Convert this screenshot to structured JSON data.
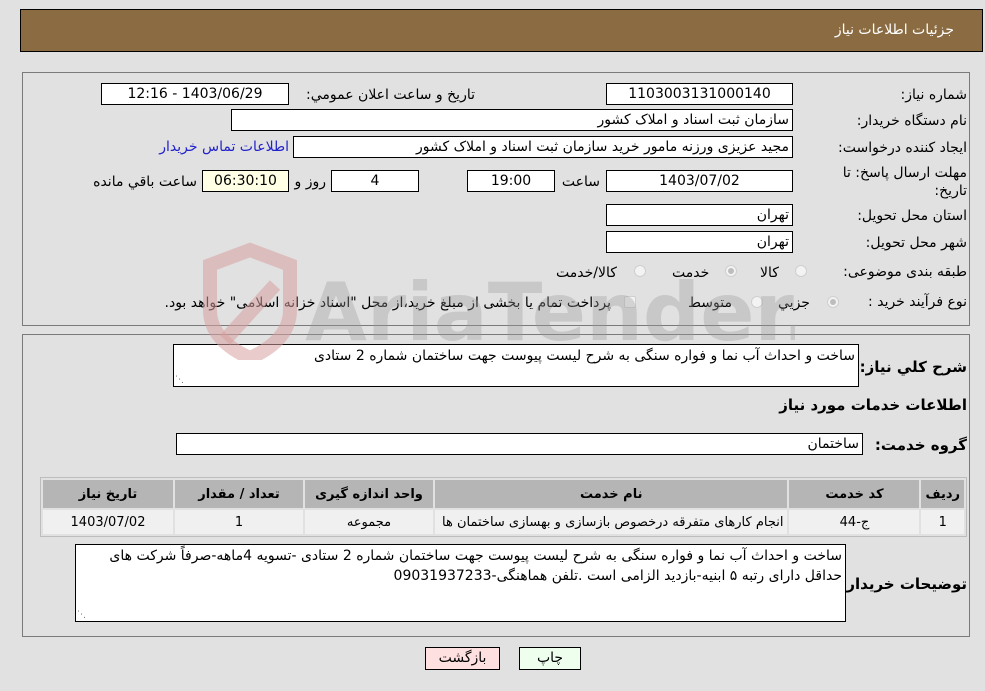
{
  "header": {
    "title": "جزئیات اطلاعات نیاز"
  },
  "form": {
    "need_number_label": "شماره نیاز:",
    "need_number": "1103003131000140",
    "announce_label": "تاریخ و ساعت اعلان عمومي:",
    "announce_value": "1403/06/29 - 12:16",
    "buyer_org_label": "نام دستگاه خريدار:",
    "buyer_org": "سازمان ثبت اسناد و املاک کشور",
    "creator_label": "ایجاد کننده درخواست:",
    "creator": "مجید عزیزی ورزنه مامور خرید سازمان ثبت اسناد و املاک کشور",
    "contact_link": "اطلاعات تماس خریدار",
    "deadline_label": "مهلت ارسال پاسخ: تا تاریخ:",
    "deadline_date": "1403/07/02",
    "time_label": "ساعت",
    "deadline_time": "19:00",
    "days_value": "4",
    "days_label": "روز و",
    "remaining_time": "06:30:10",
    "remaining_label": "ساعت باقي مانده",
    "province_label": "استان محل تحویل:",
    "province": "تهران",
    "city_label": "شهر محل تحویل:",
    "city": "تهران",
    "category_label": "طبقه بندی موضوعی:",
    "category_options": [
      {
        "label": "کالا",
        "selected": false
      },
      {
        "label": "خدمت",
        "selected": true
      },
      {
        "label": "کالا/خدمت",
        "selected": false
      }
    ],
    "process_label": "نوع فرآیند خرید :",
    "process_options": [
      {
        "label": "جزيي",
        "selected": true
      },
      {
        "label": "متوسط",
        "selected": false
      }
    ],
    "treasury_note": "پرداخت تمام یا بخشی از مبلغ خرید،از محل \"اسناد خزانه اسلامی\" خواهد بود."
  },
  "details": {
    "summary_label": "شرح کلي نياز:",
    "summary": "ساخت و احداث آب نما و فواره سنگی به شرح لیست پیوست جهت ساختمان شماره 2 ستادی",
    "services_title": "اطلاعات خدمات مورد نياز",
    "service_group_label": "گروه خدمت:",
    "service_group": "ساختمان",
    "table": {
      "headers": [
        "رديف",
        "کد خدمت",
        "نام خدمت",
        "واحد اندازه گیری",
        "تعداد / مقدار",
        "تاریخ نیاز"
      ],
      "rows": [
        [
          "1",
          "ج-44",
          "انجام کارهای متفرقه درخصوص بازسازی و بهسازی ساختمان ها",
          "مجموعه",
          "1",
          "1403/07/02"
        ]
      ]
    },
    "buyer_notes_label": "توضیحات خریدار:",
    "buyer_notes": "ساخت و احداث آب نما و فواره سنگی به شرح لیست پیوست جهت ساختمان شماره 2 ستادی -تسویه 4ماهه-صرفاً شرکت های حداقل دارای رتبه ۵ ابنیه-بازدید الزامی است .تلفن هماهنگی-09031937233"
  },
  "buttons": {
    "print": "چاپ",
    "back": "بازگشت"
  },
  "watermark": {
    "text": "AriaTender.neT"
  }
}
